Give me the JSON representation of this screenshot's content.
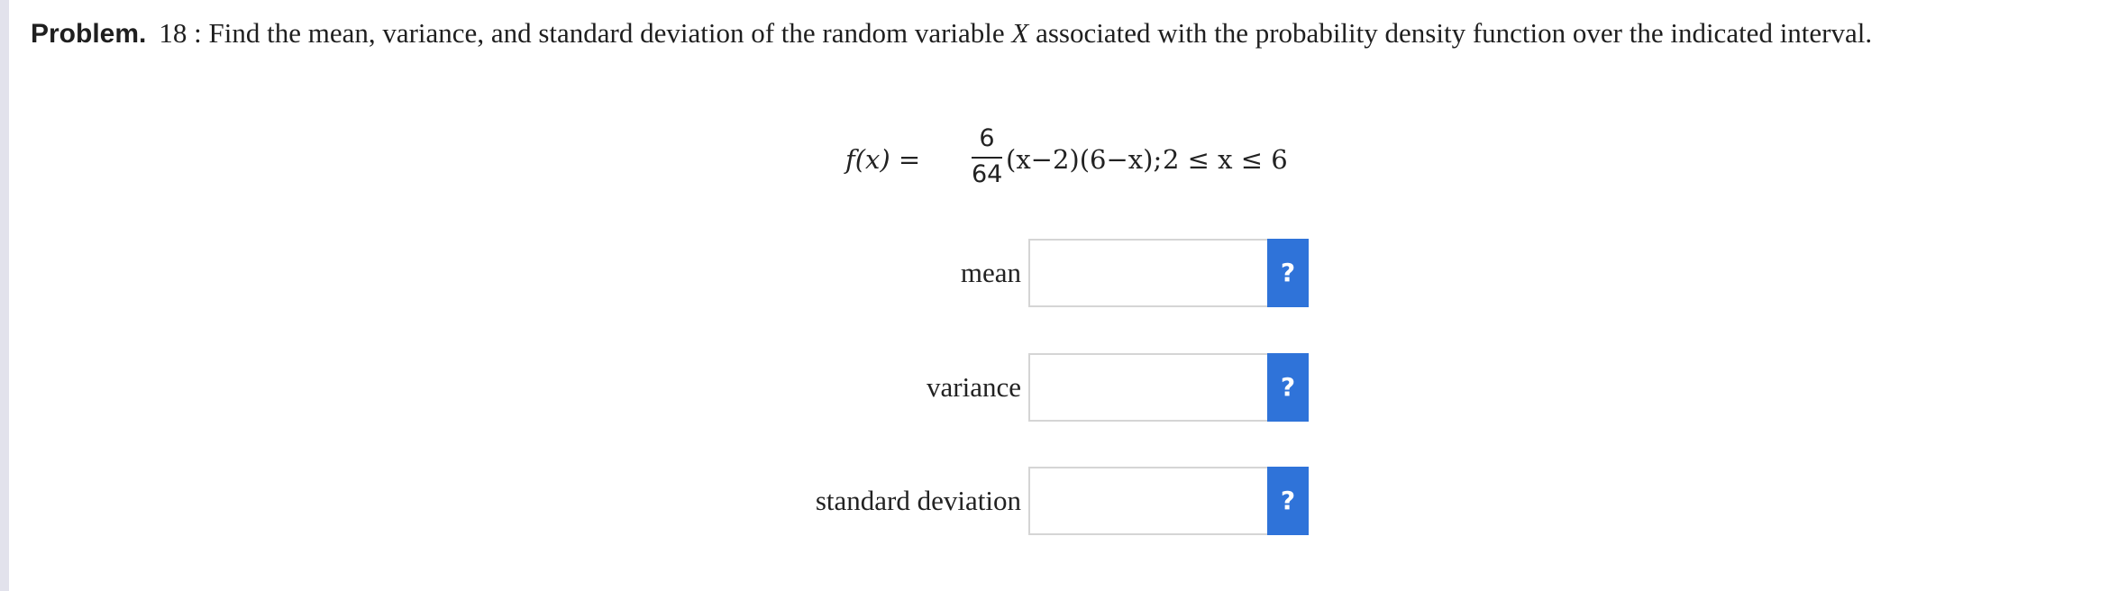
{
  "problem": {
    "label": "Problem.",
    "number_prefix": "18 : Find the mean, variance, and standard deviation of the random variable ",
    "variable": "X",
    "text_suffix": " associated with the probability density function over the indicated interval."
  },
  "formula": {
    "lhs": "f(x) =",
    "fraction_numerator": "6",
    "fraction_denominator": "64",
    "rhs": "(x−2)(6−x);",
    "interval": "2 ≤ x ≤ 6"
  },
  "fields": [
    {
      "label": "mean",
      "value": "",
      "help": "?"
    },
    {
      "label": "variance",
      "value": "",
      "help": "?"
    },
    {
      "label": "standard deviation",
      "value": "",
      "help": "?"
    }
  ],
  "colors": {
    "help_button": "#2f73d9",
    "input_border": "#d5d5d5",
    "left_bar": "#e2e2ec"
  }
}
